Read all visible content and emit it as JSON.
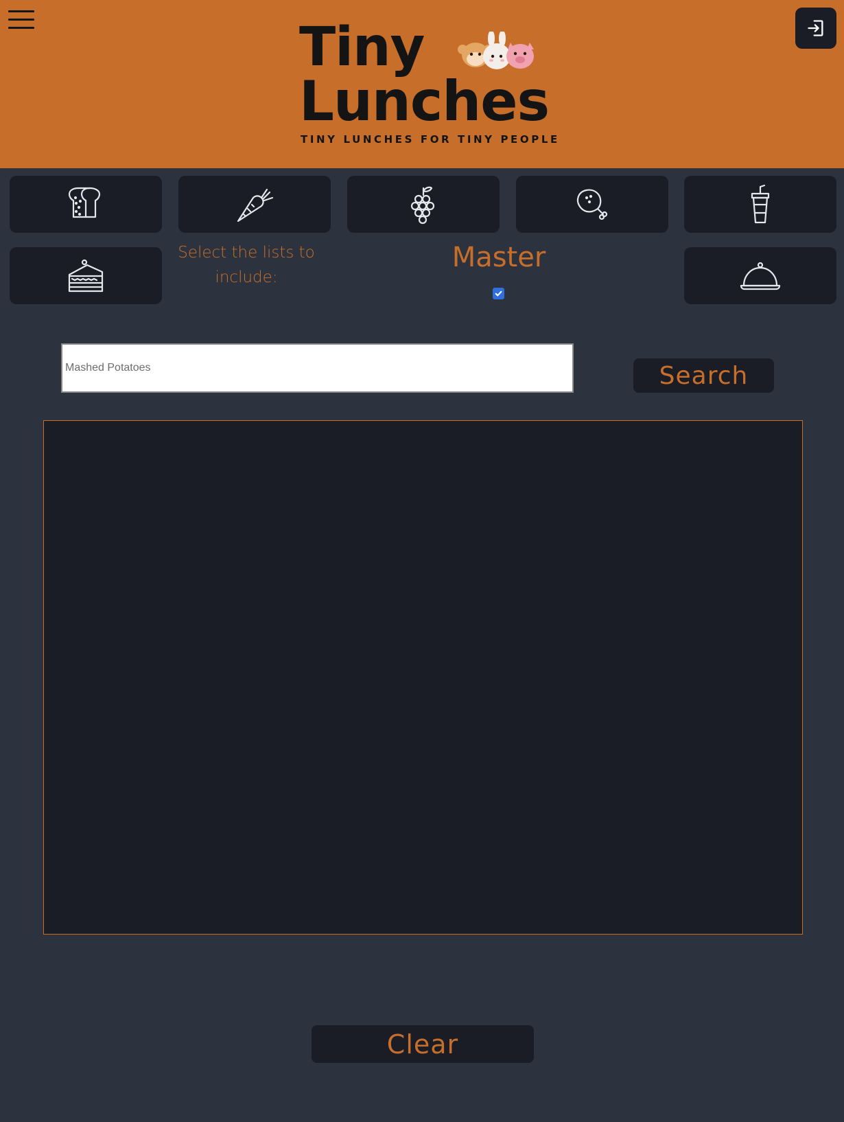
{
  "header": {
    "logo_line1": "Tiny",
    "logo_line2": "Lunches",
    "tagline": "TINY LUNCHES FOR TINY PEOPLE",
    "menu_icon": "hamburger-menu-icon",
    "login_icon": "sign-in-icon"
  },
  "categories": [
    {
      "icon": "bread-icon"
    },
    {
      "icon": "carrot-icon"
    },
    {
      "icon": "grapes-icon"
    },
    {
      "icon": "chicken-leg-icon"
    },
    {
      "icon": "drink-cup-icon"
    },
    {
      "icon": "cake-slice-icon"
    },
    {
      "icon": "serving-cloche-icon"
    }
  ],
  "filters": {
    "select_label": "Select the lists to include:",
    "master_label": "Master",
    "master_checked": true
  },
  "search": {
    "placeholder": "Mashed Potatoes",
    "value": "",
    "button_label": "Search"
  },
  "actions": {
    "clear_label": "Clear"
  },
  "colors": {
    "accent": "#c76f2a",
    "background": "#2d333e",
    "tile": "#1a1d25",
    "checkbox": "#2f6fde"
  }
}
